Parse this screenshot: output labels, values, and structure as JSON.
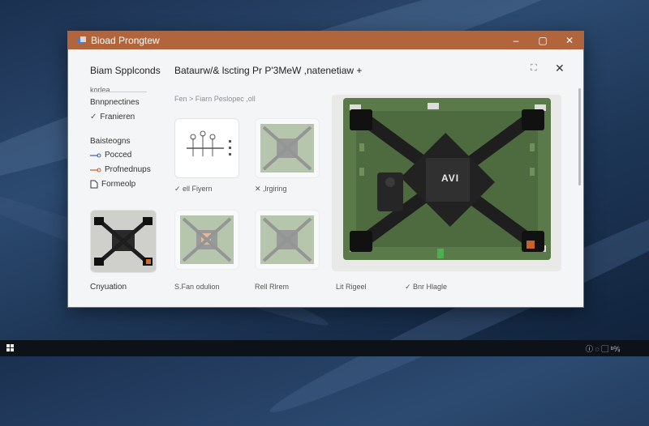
{
  "window": {
    "title": "Bioad Prongtew",
    "controls": {
      "minimize": "–",
      "maximize": "▢",
      "close": "✕"
    }
  },
  "header": {
    "sidebar_title": "Biam Spplconds",
    "breadcrumb": "Bataurw/& lscting Pr P'3MeW ,natenetiaw +",
    "expand": "⛶",
    "close": "✕"
  },
  "sidebar": {
    "items": [
      {
        "label": "korlea"
      },
      {
        "label": "Bnnpnectines"
      },
      {
        "label": "Franieren"
      },
      {
        "label": "Baisteogns"
      },
      {
        "label": "Pocced"
      },
      {
        "label": "Profnednups"
      },
      {
        "label": "Formeolp"
      }
    ],
    "bottom_label": "Cnyuation"
  },
  "filter_bar": "Fen > Fiarn Peslopec ,oll",
  "thumbnails": [
    {
      "label": "✓ ell Fiyern"
    },
    {
      "label": "✕ ,lrgiring"
    },
    {
      "label": "S.Fan odulion"
    },
    {
      "label": "Rell Rlrem"
    },
    {
      "label": "Lit Rigeel"
    },
    {
      "label": "✓ Bnr Hlagle"
    }
  ],
  "preview": {
    "chip_label": "AVI"
  },
  "taskbar": {
    "tray_text": "ⓘ ◌ ▢ ᵇ⁰⁄ᵢᵢ"
  },
  "colors": {
    "accent": "#b0653d",
    "board": "#5b7a4a"
  }
}
